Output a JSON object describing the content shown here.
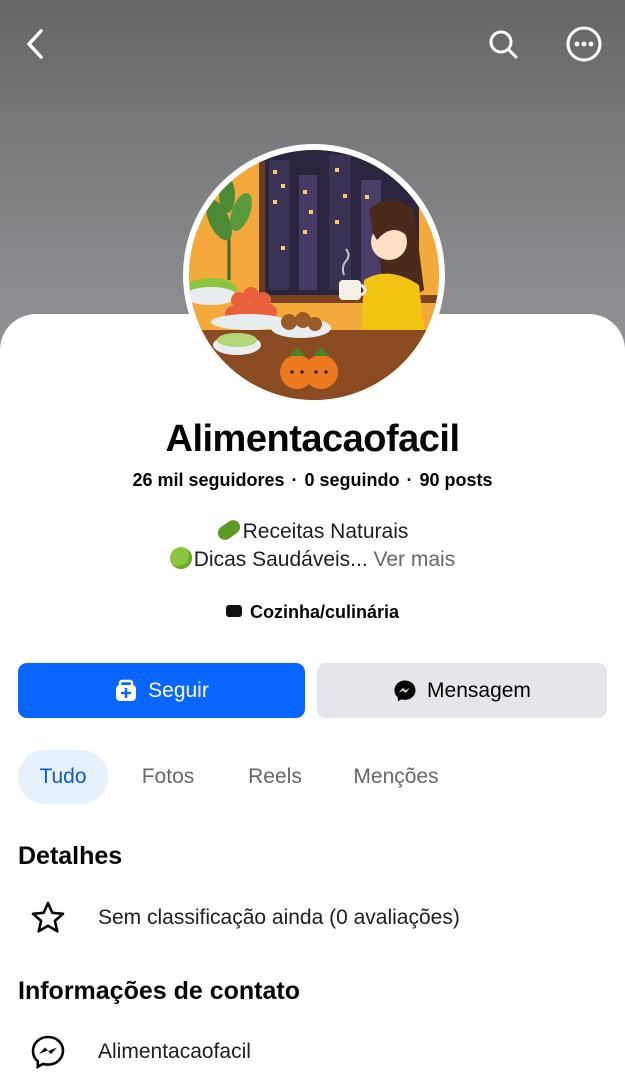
{
  "header": {
    "back_icon": "chevron-left-icon",
    "search_icon": "search-icon",
    "more_icon": "more-horizontal-icon"
  },
  "profile": {
    "name": "Alimentacaofacil",
    "followers": "26 mil seguidores",
    "following": "0 seguindo",
    "posts": "90 posts",
    "separator": "·",
    "bio_line1": "Receitas Naturais",
    "bio_line2": "Dicas Saudáveis...",
    "see_more": "Ver mais",
    "category": "Cozinha/culinária"
  },
  "actions": {
    "follow_label": "Seguir",
    "message_label": "Mensagem"
  },
  "tabs": [
    {
      "label": "Tudo",
      "active": true
    },
    {
      "label": "Fotos",
      "active": false
    },
    {
      "label": "Reels",
      "active": false
    },
    {
      "label": "Menções",
      "active": false
    }
  ],
  "details": {
    "title": "Detalhes",
    "rating_text": "Sem classificação ainda (0 avaliações)"
  },
  "contact": {
    "title": "Informações de contato",
    "messenger_name": "Alimentacaofacil"
  },
  "colors": {
    "primary": "#0866ff",
    "tab_active_bg": "#e7f0fd",
    "tab_active_text": "#0a5dc2",
    "secondary_button": "#e4e6eb"
  }
}
